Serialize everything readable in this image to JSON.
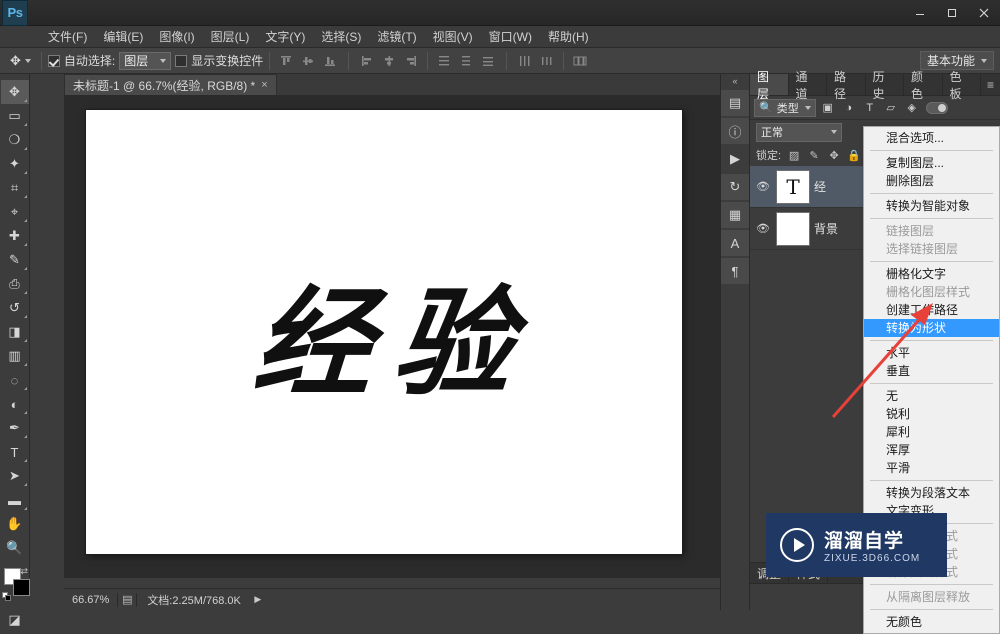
{
  "app": {
    "logo": "Ps",
    "window_buttons": [
      "minimize",
      "maximize",
      "close"
    ]
  },
  "menubar": [
    {
      "label": "文件(F)"
    },
    {
      "label": "编辑(E)"
    },
    {
      "label": "图像(I)"
    },
    {
      "label": "图层(L)"
    },
    {
      "label": "文字(Y)"
    },
    {
      "label": "选择(S)"
    },
    {
      "label": "滤镜(T)"
    },
    {
      "label": "视图(V)"
    },
    {
      "label": "窗口(W)"
    },
    {
      "label": "帮助(H)"
    }
  ],
  "options_bar": {
    "auto_select_label": "自动选择:",
    "auto_select_value": "图层",
    "show_transform_label": "显示变换控件",
    "workspace": "基本功能"
  },
  "document_tab": {
    "title": "未标题-1 @ 66.7%(经验, RGB/8) *",
    "close": "×"
  },
  "canvas": {
    "text": "经验"
  },
  "statusbar": {
    "zoom": "66.67%",
    "doc_info": "文档:2.25M/768.0K"
  },
  "panels": {
    "tabs": [
      {
        "label": "图层",
        "active": true
      },
      {
        "label": "通道",
        "active": false
      },
      {
        "label": "路径",
        "active": false
      },
      {
        "label": "历史",
        "active": false
      },
      {
        "label": "颜色",
        "active": false
      },
      {
        "label": "色板",
        "active": false
      }
    ],
    "filter": {
      "kind_label": "类型"
    },
    "blend_mode": "正常",
    "lock_label": "锁定:",
    "layers": [
      {
        "name": "经",
        "type": "text",
        "thumb": "T",
        "selected": true
      },
      {
        "name": "背景",
        "type": "image",
        "thumb": "",
        "selected": false
      }
    ],
    "bottom_tabs": [
      {
        "label": "调整",
        "active": false
      },
      {
        "label": "样式",
        "active": false
      }
    ]
  },
  "context_menu": {
    "items": [
      {
        "label": "混合选项...",
        "state": "normal"
      },
      {
        "label": "__sep__",
        "state": "sep"
      },
      {
        "label": "复制图层...",
        "state": "normal"
      },
      {
        "label": "删除图层",
        "state": "normal"
      },
      {
        "label": "__sep__",
        "state": "sep"
      },
      {
        "label": "转换为智能对象",
        "state": "normal"
      },
      {
        "label": "__sep__",
        "state": "sep"
      },
      {
        "label": "链接图层",
        "state": "disabled"
      },
      {
        "label": "选择链接图层",
        "state": "disabled"
      },
      {
        "label": "__sep__",
        "state": "sep"
      },
      {
        "label": "栅格化文字",
        "state": "normal"
      },
      {
        "label": "栅格化图层样式",
        "state": "disabled"
      },
      {
        "label": "创建工作路径",
        "state": "normal"
      },
      {
        "label": "转换为形状",
        "state": "highlight"
      },
      {
        "label": "__sep__",
        "state": "sep"
      },
      {
        "label": "水平",
        "state": "normal"
      },
      {
        "label": "垂直",
        "state": "normal"
      },
      {
        "label": "__sep__",
        "state": "sep"
      },
      {
        "label": "无",
        "state": "normal"
      },
      {
        "label": "锐利",
        "state": "normal"
      },
      {
        "label": "犀利",
        "state": "normal"
      },
      {
        "label": "浑厚",
        "state": "normal"
      },
      {
        "label": "平滑",
        "state": "normal"
      },
      {
        "label": "__sep__",
        "state": "sep"
      },
      {
        "label": "转换为段落文本",
        "state": "normal"
      },
      {
        "label": "文字变形...",
        "state": "normal"
      },
      {
        "label": "__sep__",
        "state": "sep"
      },
      {
        "label": "拷贝图层样式",
        "state": "disabled"
      },
      {
        "label": "粘贴图层样式",
        "state": "disabled"
      },
      {
        "label": "清除图层样式",
        "state": "disabled"
      },
      {
        "label": "__sep__",
        "state": "sep"
      },
      {
        "label": "从隔离图层释放",
        "state": "disabled"
      },
      {
        "label": "__sep__",
        "state": "sep"
      },
      {
        "label": "无颜色",
        "state": "normal"
      }
    ]
  },
  "annotation": {
    "arrow_color": "#e8413a"
  },
  "watermark": {
    "title": "溜溜自学",
    "subtitle": "ZIXUE.3D66.COM",
    "bg_color": "#1f3864"
  },
  "tools": [
    {
      "name": "move-tool",
      "glyph": "✥",
      "selected": true
    },
    {
      "name": "marquee-tool",
      "glyph": "▭",
      "selected": false
    },
    {
      "name": "lasso-tool",
      "glyph": "✎",
      "selected": false
    },
    {
      "name": "quick-select-tool",
      "glyph": "✧",
      "selected": false
    },
    {
      "name": "crop-tool",
      "glyph": "⌗",
      "selected": false
    },
    {
      "name": "eyedropper-tool",
      "glyph": "⌖",
      "selected": false
    },
    {
      "name": "healing-brush-tool",
      "glyph": "✚",
      "selected": false
    },
    {
      "name": "brush-tool",
      "glyph": "🖌",
      "selected": false
    },
    {
      "name": "clone-stamp-tool",
      "glyph": "⎙",
      "selected": false
    },
    {
      "name": "history-brush-tool",
      "glyph": "↺",
      "selected": false
    },
    {
      "name": "eraser-tool",
      "glyph": "◨",
      "selected": false
    },
    {
      "name": "gradient-tool",
      "glyph": "▥",
      "selected": false
    },
    {
      "name": "blur-tool",
      "glyph": "◌",
      "selected": false
    },
    {
      "name": "dodge-tool",
      "glyph": "◐",
      "selected": false
    },
    {
      "name": "pen-tool",
      "glyph": "✒",
      "selected": false
    },
    {
      "name": "type-tool",
      "glyph": "T",
      "selected": false
    },
    {
      "name": "path-selection-tool",
      "glyph": "➤",
      "selected": false
    },
    {
      "name": "rectangle-tool",
      "glyph": "▬",
      "selected": false
    },
    {
      "name": "hand-tool",
      "glyph": "✋",
      "selected": false
    },
    {
      "name": "zoom-tool",
      "glyph": "🔍",
      "selected": false
    }
  ]
}
